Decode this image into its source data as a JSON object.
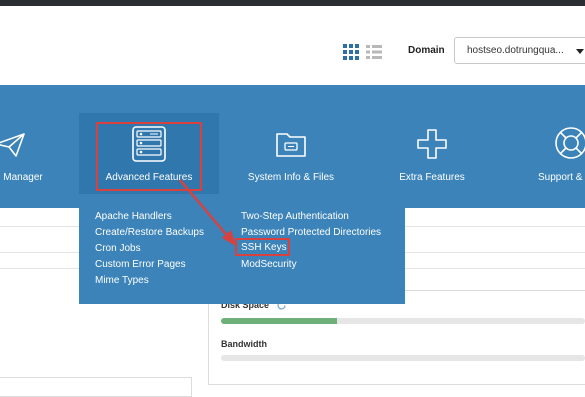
{
  "header": {
    "domain_label": "Domain",
    "domain_value": "hostseo.dotrungqua..."
  },
  "nav": {
    "items": [
      {
        "label": "Manager",
        "icon": "paper-plane-icon"
      },
      {
        "label": "Advanced Features",
        "icon": "server-settings-icon",
        "active": true
      },
      {
        "label": "System Info & Files",
        "icon": "folder-icon"
      },
      {
        "label": "Extra Features",
        "icon": "plus-icon"
      },
      {
        "label": "Support &",
        "icon": "lifebuoy-icon"
      }
    ]
  },
  "dropdown": {
    "left": [
      "Apache Handlers",
      "Create/Restore Backups",
      "Cron Jobs",
      "Custom Error Pages",
      "Mime Types"
    ],
    "right": [
      "Two-Step Authentication",
      "Password Protected Directories",
      "SSH Keys",
      "ModSecurity"
    ]
  },
  "usage": {
    "disk_label": "Disk Space",
    "disk_fraction": 0.32,
    "bandwidth_label": "Bandwidth",
    "bandwidth_fraction": 0
  },
  "colors": {
    "nav_bg": "#3b83b8",
    "annotation_red": "#d9413f",
    "progress_green": "#6fb07a"
  }
}
